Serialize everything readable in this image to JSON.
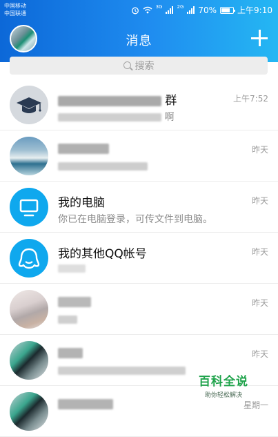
{
  "status_bar": {
    "carrier_1": "中国移动",
    "carrier_2": "中国联通",
    "network_1": "3G",
    "network_2": "2G",
    "battery": "70%",
    "time": "上午9:10"
  },
  "header": {
    "title": "消息"
  },
  "search": {
    "placeholder": "搜索"
  },
  "conversations": [
    {
      "name_suffix": "群",
      "preview_suffix": "啊",
      "time": "上午7:52",
      "avatar_icon": "graduation-cap-icon"
    },
    {
      "time": "昨天"
    },
    {
      "name": "我的电脑",
      "preview": "你已在电脑登录，可传文件到电脑。",
      "time": "昨天",
      "avatar_icon": "monitor-icon"
    },
    {
      "name": "我的其他QQ帐号",
      "time": "昨天",
      "avatar_icon": "qq-bell-icon"
    },
    {
      "time": "昨天"
    },
    {
      "time": "昨天"
    },
    {
      "time": "星期一"
    }
  ],
  "watermark": {
    "title": "百科全说",
    "subtitle": "助你轻松解决"
  },
  "colors": {
    "header_start": "#0c68d8",
    "header_end": "#25b7f3",
    "accent": "#0fa8ee",
    "watermark": "#1fa34b"
  }
}
